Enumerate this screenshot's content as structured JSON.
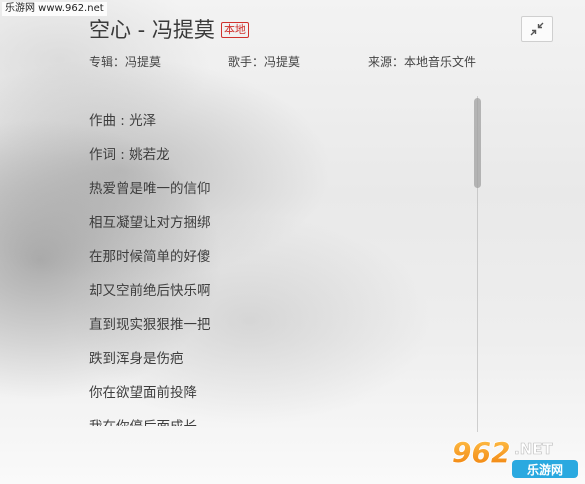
{
  "watermark_top": "乐游网 www.962.net",
  "header": {
    "title": "空心 - 冯提莫",
    "badge": "本地"
  },
  "meta": {
    "album": "专辑：冯提莫",
    "artist": "歌手：冯提莫",
    "source": "来源：本地音乐文件"
  },
  "lyrics": [
    "作曲 : 光泽",
    "作词 : 姚若龙",
    "热爱曾是唯一的信仰",
    "相互凝望让对方捆绑",
    "在那时候简单的好傻",
    "却又空前绝后快乐啊",
    "直到现实狠狠推一把",
    "跌到浑身是伤疤",
    "你在欲望面前投降",
    "我在你停后面成长"
  ],
  "scrollbar": {
    "position": 0.0,
    "visible_fraction": 0.27
  },
  "watermark_logo": {
    "number": "962",
    "suffix": ".NET",
    "tagline": "乐游网"
  },
  "icons": {
    "shrink": "collapse-arrows-icon"
  },
  "colors": {
    "badge": "#d0312d",
    "logo_orange": "#f39a1e",
    "logo_blue": "#2aa9e0"
  }
}
